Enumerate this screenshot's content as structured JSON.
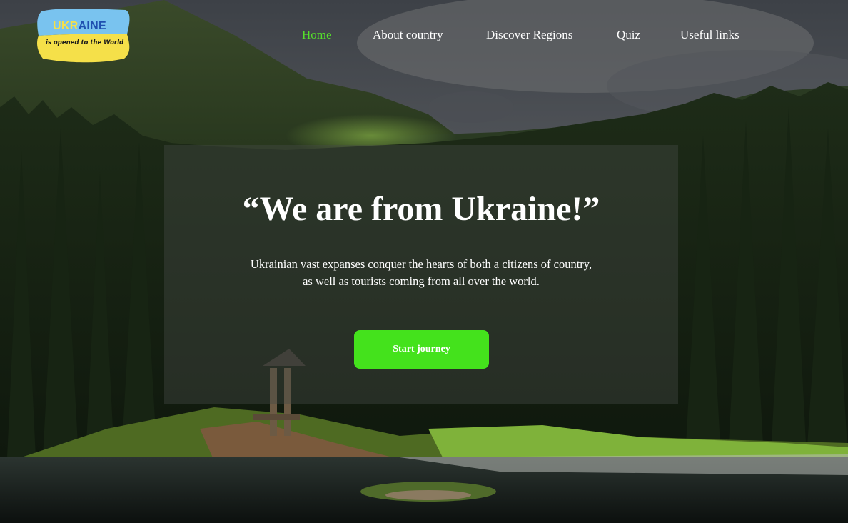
{
  "header": {
    "logo": {
      "title": "UKRAINE",
      "subtitle": "is opened to the World"
    },
    "nav": [
      {
        "label": "Home",
        "active": true
      },
      {
        "label": "About country",
        "active": false
      },
      {
        "label": "Discover Regions",
        "active": false
      },
      {
        "label": "Quiz",
        "active": false
      },
      {
        "label": "Useful links",
        "active": false
      }
    ]
  },
  "hero": {
    "title": "“We are from Ukraine!”",
    "text_line_1": "Ukrainian vast expanses conquer the hearts of both a citizens of country,",
    "text_line_2": "as well as tourists coming from all over the world.",
    "button_label": "Start journey"
  },
  "colors": {
    "accent": "#44e21c",
    "nav_active": "#55e12b",
    "logo_blue": "#1f4fb0",
    "logo_yellow": "#f5e049"
  }
}
